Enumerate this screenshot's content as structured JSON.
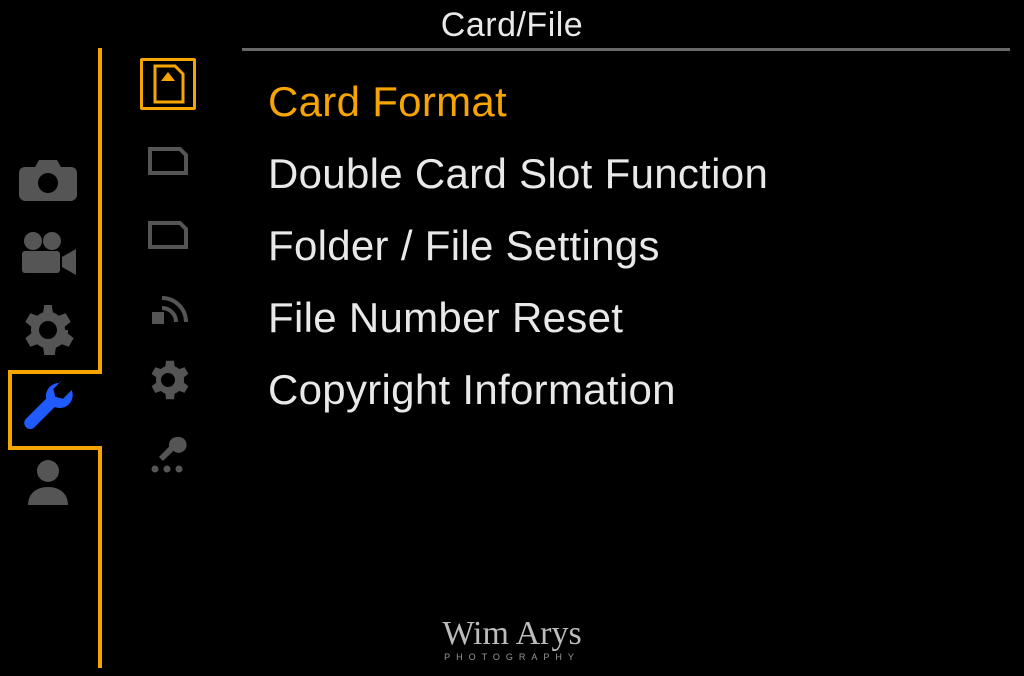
{
  "title": "Card/File",
  "main_tabs": {
    "camera": {
      "name": "camera-icon"
    },
    "video": {
      "name": "video-icon"
    },
    "gear": {
      "name": "gear-icon"
    },
    "wrench": {
      "name": "wrench-icon",
      "active": true
    },
    "person": {
      "name": "person-icon"
    }
  },
  "sub_tabs": [
    {
      "name": "card-eject-icon",
      "active": true
    },
    {
      "name": "card-slot-icon"
    },
    {
      "name": "folder-icon"
    },
    {
      "name": "wireless-icon"
    },
    {
      "name": "gear-icon"
    },
    {
      "name": "tool-dots-icon"
    }
  ],
  "menu": {
    "items": [
      {
        "label": "Card Format",
        "selected": true
      },
      {
        "label": "Double Card Slot Function"
      },
      {
        "label": "Folder / File Settings"
      },
      {
        "label": "File Number Reset"
      },
      {
        "label": "Copyright Information"
      }
    ]
  },
  "watermark": {
    "name": "Wim Arys",
    "sub": "PHOTOGRAPHY"
  },
  "colors": {
    "accent": "#f6a400",
    "active_main": "#1f5bff",
    "text": "#e9e9e9",
    "muted": "#555555"
  }
}
